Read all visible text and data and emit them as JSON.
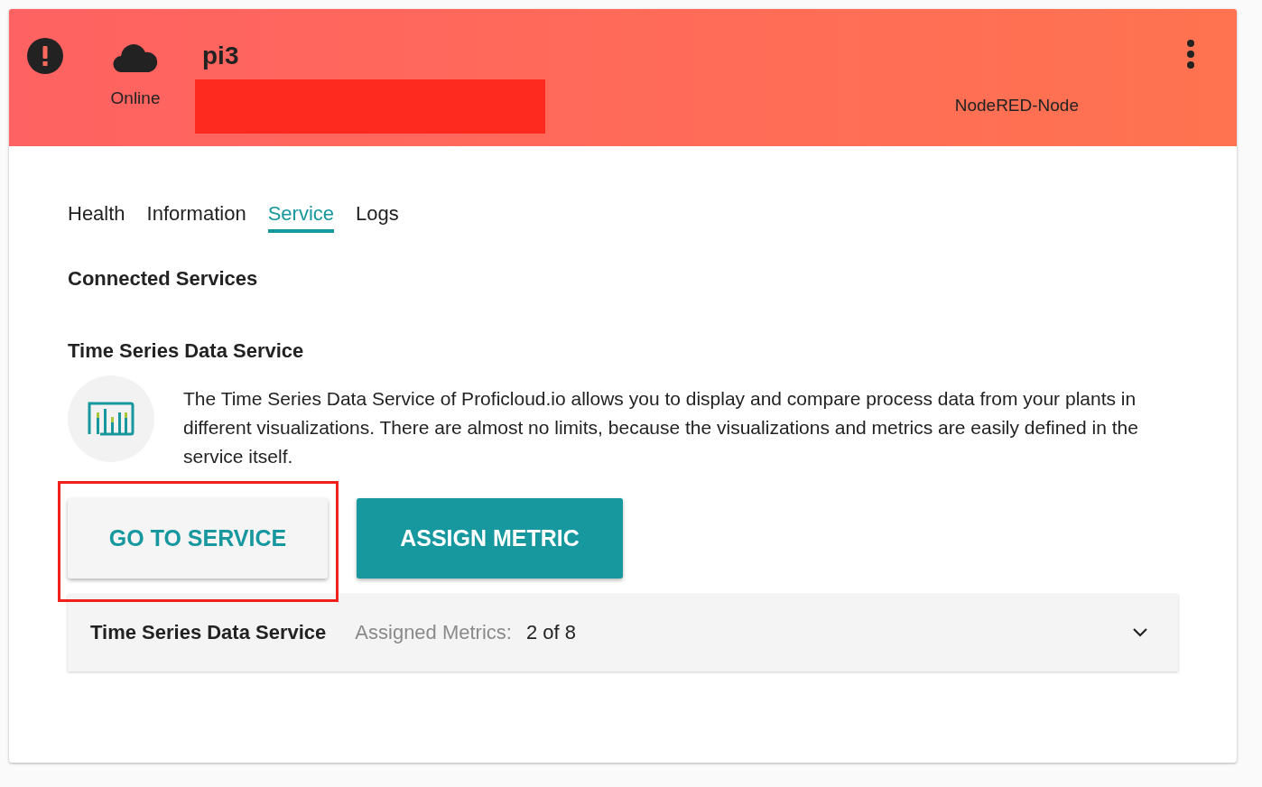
{
  "device": {
    "name": "pi3",
    "status": "Online",
    "type": "NodeRED-Node",
    "alert": true,
    "redacted": true
  },
  "tabs": [
    {
      "label": "Health",
      "selected": false
    },
    {
      "label": "Information",
      "selected": false
    },
    {
      "label": "Service",
      "selected": true
    },
    {
      "label": "Logs",
      "selected": false
    }
  ],
  "section_title": "Connected Services",
  "service": {
    "title": "Time Series Data Service",
    "description": "The Time Series Data Service of Proficloud.io allows you to display and compare process data from your plants in different visualizations. There are almost no limits, because the visualizations and metrics are easily defined in the service itself.",
    "buttons": [
      {
        "label": "GO TO SERVICE",
        "kind": "secondary",
        "highlighted": true
      },
      {
        "label": "ASSIGN METRIC",
        "kind": "primary",
        "highlighted": false
      }
    ],
    "panel": {
      "title": "Time Series Data Service",
      "metrics_label": "Assigned Metrics:",
      "metrics_value": "2 of 8",
      "expanded": false
    }
  }
}
